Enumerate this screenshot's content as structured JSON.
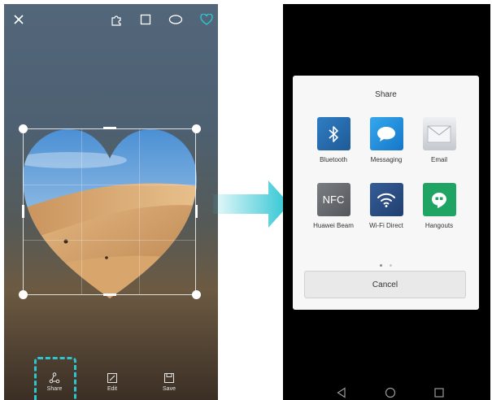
{
  "left_screen": {
    "toolbar": {
      "close_icon": "x-icon",
      "shape_icons": [
        "puzzle-icon",
        "square-icon",
        "ellipse-icon",
        "heart-icon"
      ],
      "active_shape": "heart-icon",
      "accent_color": "#2ec5d3"
    },
    "bottom_bar": {
      "share_label": "Share",
      "edit_label": "Edit",
      "save_label": "Save"
    }
  },
  "share_sheet": {
    "title": "Share",
    "apps": [
      {
        "label": "Bluetooth",
        "icon": "bluetooth-icon",
        "color": "#2a6fb0"
      },
      {
        "label": "Messaging",
        "icon": "message-bubble-icon",
        "color": "#1e90d8"
      },
      {
        "label": "Email",
        "icon": "envelope-icon",
        "color": "#c9ced4"
      },
      {
        "label": "Huawei Beam",
        "icon": "nfc-icon",
        "color": "#6b6f74"
      },
      {
        "label": "Wi-Fi Direct",
        "icon": "wifi-icon",
        "color": "#2c4f86"
      },
      {
        "label": "Hangouts",
        "icon": "quote-icon",
        "color": "#1fa463"
      }
    ],
    "nfc_text": "NFC",
    "page_indicator": {
      "count": 2,
      "active": 0
    },
    "cancel_label": "Cancel"
  },
  "nav_bar": [
    "back-icon",
    "home-icon",
    "recents-icon"
  ]
}
